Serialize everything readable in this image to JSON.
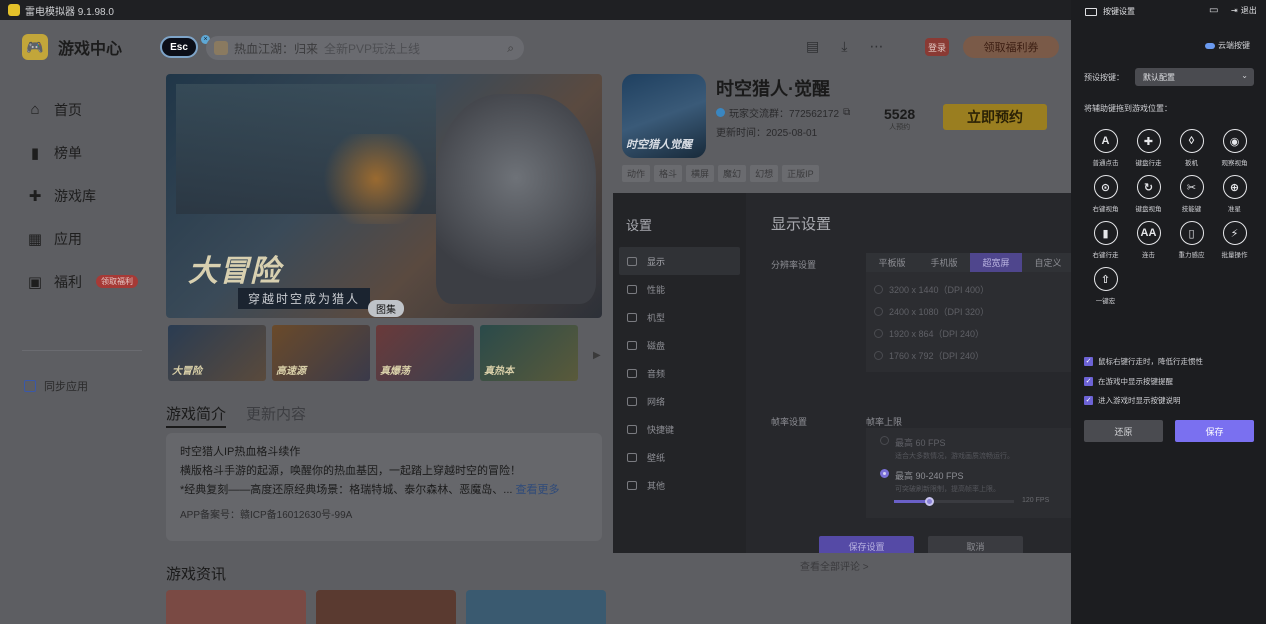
{
  "window": {
    "title": "雷电模拟器 9.1.98.0"
  },
  "app": {
    "brand": "游戏中心",
    "nav": [
      {
        "label": "首页",
        "icon": "home-icon"
      },
      {
        "label": "榜单",
        "icon": "chart-icon"
      },
      {
        "label": "游戏库",
        "icon": "gamepad-icon"
      },
      {
        "label": "应用",
        "icon": "apps-icon"
      },
      {
        "label": "福利",
        "icon": "gift-icon",
        "tag": "领取福利"
      }
    ],
    "sync_label": "同步应用",
    "esc_label": "Esc",
    "search": {
      "text": "热血江湖：归来",
      "placeholder": "全新PVP玩法上线"
    },
    "login": "登录",
    "welfare": "领取福利券"
  },
  "banner": {
    "title": "大冒险",
    "subtitle": "穿越时空成为猎人",
    "label": "图集",
    "thumbs": [
      "大冒险",
      "高速源",
      "真爆荡",
      "真热本"
    ]
  },
  "tabs": {
    "intro": "游戏简介",
    "updates": "更新内容"
  },
  "description": {
    "line1": "时空猎人IP热血格斗续作",
    "line2": "横版格斗手游的起源，唤醒你的热血基因，一起踏上穿越时空的冒险！",
    "line3": "*经典复刻——高度还原经典场景：格瑞特城、泰尔森林、恶魔岛、...",
    "more": "查看更多",
    "icp": "APP备案号：赣ICP备16012630号-99A"
  },
  "news_title": "游戏资讯",
  "game": {
    "title": "时空猎人·觉醒",
    "icon_text": "时空猎人觉醒",
    "qq_group": "玩家交流群：772562172",
    "update": "更新时间：2025-08-01",
    "tags": [
      "动作",
      "格斗",
      "横屏",
      "魔幻",
      "幻想",
      "正版IP"
    ],
    "count": "5528",
    "count_label": "人预约",
    "reserve": "立即预约",
    "more_reviews": "查看全部评论 >"
  },
  "dialog": {
    "title": "设置",
    "menu": [
      "显示",
      "性能",
      "机型",
      "磁盘",
      "音频",
      "网络",
      "快捷键",
      "壁纸",
      "其他"
    ],
    "heading": "显示设置",
    "resolution_label": "分辨率设置",
    "res_tabs": [
      "平板版",
      "手机版",
      "超宽屏",
      "自定义"
    ],
    "res_options": [
      "3200 x 1440（DPI 400）",
      "2400 x 1080（DPI 320）",
      "1920 x 864（DPI 240）",
      "1760 x 792（DPI 240）"
    ],
    "fps_label": "帧率设置",
    "fps_sub": "帧率上限",
    "fps_options": [
      {
        "title": "最高 60 FPS",
        "desc": "适合大多数情况，游戏画质流畅运行。"
      },
      {
        "title": "最高 90-240 FPS",
        "desc": "可突破刷新限制，提高帧率上限。"
      }
    ],
    "fps_value": "120 FPS",
    "fps_fraction": 0.3,
    "save": "保存设置",
    "cancel": "取消"
  },
  "panel": {
    "title": "按键设置",
    "exit": "退出",
    "cloud": "云端按键",
    "preset_label": "预设按键：",
    "preset_value": "默认配置",
    "hint": "将辅助键拖到游戏位置：",
    "keys": [
      {
        "glyph": "A",
        "label": "普通点击"
      },
      {
        "glyph": "✚",
        "label": "键盘行走"
      },
      {
        "glyph": "◊",
        "label": "扳机"
      },
      {
        "glyph": "◉",
        "label": "观察视角"
      },
      {
        "glyph": "⊙",
        "label": "右键视角"
      },
      {
        "glyph": "↻",
        "label": "键盘视角"
      },
      {
        "glyph": "✂",
        "label": "技能键"
      },
      {
        "glyph": "⊕",
        "label": "准星"
      },
      {
        "glyph": "▮",
        "label": "右键行走"
      },
      {
        "glyph": "AA",
        "label": "连击"
      },
      {
        "glyph": "▯",
        "label": "重力感应"
      },
      {
        "glyph": "⚡",
        "label": "批量操作"
      },
      {
        "glyph": "⇧",
        "label": "一键宏"
      }
    ],
    "checks": [
      "鼠标右键行走时，降低行走惯性",
      "在游戏中显示按键提醒",
      "进入游戏时显示按键说明"
    ],
    "reset": "还原",
    "save": "保存"
  }
}
